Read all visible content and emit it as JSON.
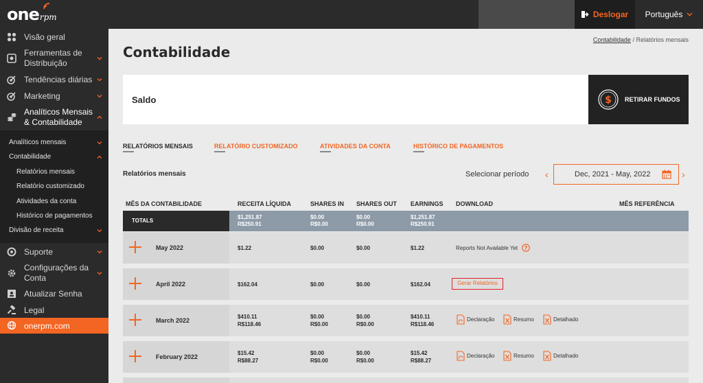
{
  "header": {
    "logo_one": "one",
    "logo_rpm": "rpm",
    "logout_label": "Deslogar",
    "language": "Português"
  },
  "sidebar": {
    "items": [
      {
        "label": "Visão geral",
        "icon": "dashboard-icon"
      },
      {
        "label": "Ferramentas de Distribuição",
        "icon": "distribution-icon"
      },
      {
        "label": "Tendências diárias",
        "icon": "trends-icon"
      },
      {
        "label": "Marketing",
        "icon": "marketing-icon"
      },
      {
        "label": "Analíticos Mensais & Contabilidade",
        "icon": "coins-icon"
      },
      {
        "label": "Suporte",
        "icon": "support-icon"
      },
      {
        "label": "Configurações da Conta",
        "icon": "gear-icon"
      },
      {
        "label": "Atualizar Senha",
        "icon": "password-icon"
      },
      {
        "label": "Legal",
        "icon": "gavel-icon"
      },
      {
        "label": "onerpm.com",
        "icon": "globe-icon"
      }
    ],
    "sub": {
      "analiticos": "Analíticos mensais",
      "contabilidade": "Contabilidade",
      "relatorios_mensais": "Relatórios mensais",
      "relatorio_customizado": "Relatório customizado",
      "atividades": "Atividades da conta",
      "historico": "Histórico de pagamentos",
      "divisao": "Divisão de receita"
    }
  },
  "breadcrumb": {
    "link": "Contabilidade",
    "separator": "/",
    "current": "Relatórios mensais"
  },
  "page_title": "Contabilidade",
  "saldo_label": "Saldo",
  "withdraw_label": "RETIRAR FUNDOS",
  "tabs": [
    "RELATÓRIOS MENSAIS",
    "RELATÓRIO CUSTOMIZADO",
    "ATIVIDADES DA CONTA",
    "HISTÓRICO DE PAGAMENTOS"
  ],
  "section_title": "Relatórios mensais",
  "period_label": "Selecionar período",
  "period_value": "Dec, 2021 - May, 2022",
  "columns": [
    "MÊS DA CONTABILIDADE",
    "RECEITA LÍQUIDA",
    "SHARES IN",
    "SHARES OUT",
    "EARNINGS",
    "DOWNLOAD",
    "MÊS REFERÊNCIA"
  ],
  "totals": {
    "label": "TOTALS",
    "receita": [
      "$1,251.87",
      "R$250.91"
    ],
    "shares_in": [
      "$0.00",
      "R$0.00"
    ],
    "shares_out": [
      "$0.00",
      "R$0.00"
    ],
    "earnings": [
      "$1,251.87",
      "R$250.91"
    ]
  },
  "rows": [
    {
      "month": "May 2022",
      "receita": [
        "$1.22"
      ],
      "shares_in": [
        "$0.00"
      ],
      "shares_out": [
        "$0.00"
      ],
      "earnings": [
        "$1.22"
      ],
      "download": "Reports Not Available Yet"
    },
    {
      "month": "April 2022",
      "receita": [
        "$162.04"
      ],
      "shares_in": [
        "$0.00"
      ],
      "shares_out": [
        "$0.00"
      ],
      "earnings": [
        "$162.04"
      ],
      "download": "Gerar Relatórios"
    },
    {
      "month": "March 2022",
      "receita": [
        "$410.11",
        "R$118.46"
      ],
      "shares_in": [
        "$0.00",
        "R$0.00"
      ],
      "shares_out": [
        "$0.00",
        "R$0.00"
      ],
      "earnings": [
        "$410.11",
        "R$118.46"
      ],
      "downloads": [
        "Declaração",
        "Resumo",
        "Detalhado"
      ]
    },
    {
      "month": "February 2022",
      "receita": [
        "$15.42",
        "R$88.27"
      ],
      "shares_in": [
        "$0.00",
        "R$0.00"
      ],
      "shares_out": [
        "$0.00",
        "R$0.00"
      ],
      "earnings": [
        "$15.42",
        "R$88.27"
      ],
      "downloads": [
        "Declaração",
        "Resumo",
        "Detalhado"
      ]
    }
  ],
  "colors": {
    "accent": "#f26522",
    "dark": "#2b2b2b",
    "totals_bg": "#8d9aa7",
    "error_border": "#e31e24"
  }
}
